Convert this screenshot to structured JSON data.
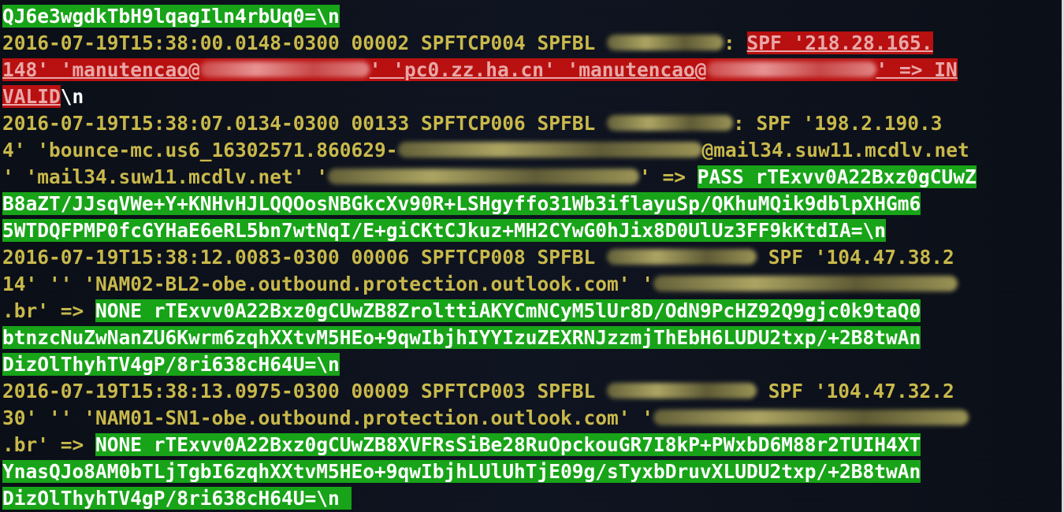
{
  "terminal": {
    "lines": {
      "l0": {
        "a": "QJ6e3wgdkTbH9lqagIln4rbUq0=\\n"
      },
      "l1": {
        "a": "2016-07-19T15:38:00.0148-0300 00002 SPFTCP004 SPFBL ",
        "b": ": ",
        "c": "SPF '218.28.165."
      },
      "l2": {
        "a": "148' 'manutencao@",
        "b": "' 'pc0.zz.ha.cn' 'manutencao@",
        "c": "' => IN"
      },
      "l3": {
        "a": "VALID",
        "b": "\\n"
      },
      "l4": {
        "a": "2016-07-19T15:38:07.0134-0300 00133 SPFTCP006 SPFBL ",
        "b": ": SPF '198.2.190.3"
      },
      "l5": {
        "a": "4' 'bounce-mc.us6_16302571.860629-",
        "b": "@mail34.suw11.mcdlv.net"
      },
      "l6": {
        "a": "' 'mail34.suw11.mcdlv.net' '",
        "b": "' => ",
        "c": "PASS rTExvv0A22Bxz0gCUwZ"
      },
      "l7": {
        "a": "B8aZT/JJsqVWe+Y+KNHvHJLQQOosNBGkcXv90R+LSHgyffo31Wb3iflayuSp/QKhuMQik9dblpXHGm6"
      },
      "l8": {
        "a": "5WTDQFPMP0fcGYHaE6eRL5bn7wtNqI/E+giCKtCJkuz+MH2CYwG0hJix8D0UlUz3FF9kKtdIA=\\n"
      },
      "l9": {
        "a": "2016-07-19T15:38:12.0083-0300 00006 SPFTCP008 SPFBL ",
        "b": " SPF '104.47.38.2"
      },
      "l10": {
        "a": "14' '' 'NAM02-BL2-obe.outbound.protection.outlook.com' '"
      },
      "l11": {
        "a": ".br' => ",
        "b": "NONE rTExvv0A22Bxz0gCUwZB8ZrolttiAKYCmNCyM5lUr8D/OdN9PcHZ92Q9gjc0k9taQ0"
      },
      "l12": {
        "a": "btnzcNuZwNanZU6Kwrm6zqhXXtvM5HEo+9qwIbjhIYYIzuZEXRNJzzmjThEbH6LUDU2txp/+2B8twAn"
      },
      "l13": {
        "a": "DizOlThyhTV4gP/8ri638cH64U=\\n"
      },
      "l14": {
        "a": "2016-07-19T15:38:13.0975-0300 00009 SPFTCP003 SPFBL ",
        "b": " SPF '104.47.32.2"
      },
      "l15": {
        "a": "30' '' 'NAM01-SN1-obe.outbound.protection.outlook.com' '"
      },
      "l16": {
        "a": ".br' => ",
        "b": "NONE rTExvv0A22Bxz0gCUwZB8XVFRsSiBe28RuOpckouGR7I8kP+PWxbD6M88r2TUIH4XT"
      },
      "l17": {
        "a": "YnasQJo8AM0bTLjTgbI6zqhXXtvM5HEo+9qwIbjhLUlUhTjE09g/sTyxbDruvXLUDU2txp/+2B8twAn"
      },
      "l18": {
        "a": "DizOlThyhTV4gP/8ri638cH64U=\\n "
      }
    },
    "colors": {
      "background": "#0b0f18",
      "default_text": "#c8b84a",
      "highlight_green": "#17a317",
      "highlight_red": "#b80f0f"
    }
  }
}
